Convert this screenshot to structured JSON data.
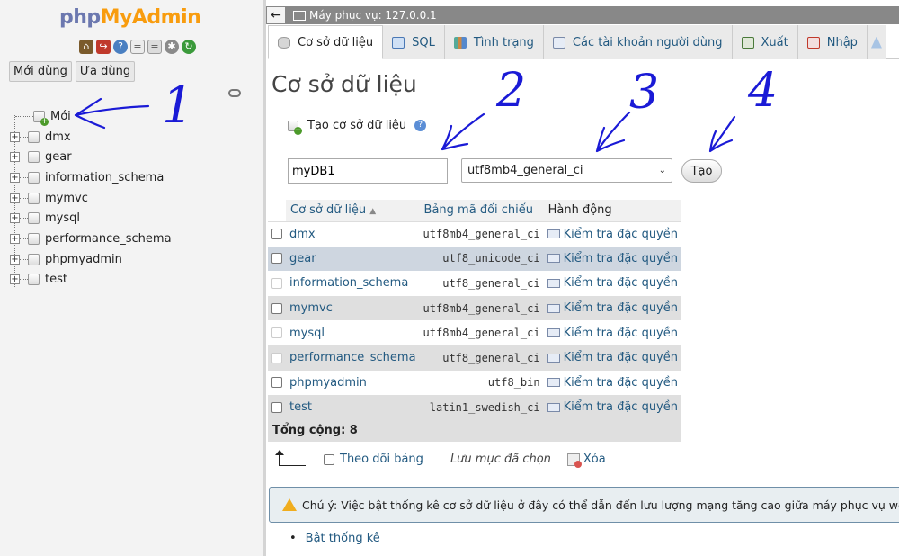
{
  "nav": {
    "logo_php": "php",
    "logo_myadmin": "MyAdmin",
    "btn_recent": "Mới dùng",
    "btn_favorite": "Ưa dùng",
    "tree": [
      {
        "name": "Mới",
        "type": "new"
      },
      {
        "name": "dmx"
      },
      {
        "name": "gear"
      },
      {
        "name": "information_schema"
      },
      {
        "name": "mymvc"
      },
      {
        "name": "mysql"
      },
      {
        "name": "performance_schema"
      },
      {
        "name": "phpmyadmin"
      },
      {
        "name": "test"
      }
    ]
  },
  "topbar": {
    "server": "Máy phục vụ: 127.0.0.1"
  },
  "tabs": [
    {
      "label": "Cơ sở dữ liệu",
      "icon": "database-icon",
      "active": true
    },
    {
      "label": "SQL",
      "icon": "sql-icon"
    },
    {
      "label": "Tình trạng",
      "icon": "status-icon"
    },
    {
      "label": "Các tài khoản người dùng",
      "icon": "users-icon"
    },
    {
      "label": "Xuất",
      "icon": "export-icon"
    },
    {
      "label": "Nhập",
      "icon": "import-icon"
    }
  ],
  "main": {
    "title": "Cơ sở dữ liệu",
    "create_label": "Tạo cơ sở dữ liệu",
    "db_name_value": "myDB1",
    "collation_selected": "utf8mb4_general_ci",
    "create_button": "Tạo"
  },
  "table": {
    "headers": {
      "name": "Cơ sở dữ liệu",
      "collation": "Bảng mã đối chiếu",
      "action": "Hành động"
    },
    "rows": [
      {
        "name": "dmx",
        "collation": "utf8mb4_general_ci",
        "action": "Kiểm tra đặc quyền"
      },
      {
        "name": "gear",
        "collation": "utf8_unicode_ci",
        "action": "Kiểm tra đặc quyền"
      },
      {
        "name": "information_schema",
        "collation": "utf8_general_ci",
        "action": "Kiểm tra đặc quyền"
      },
      {
        "name": "mymvc",
        "collation": "utf8mb4_general_ci",
        "action": "Kiểm tra đặc quyền"
      },
      {
        "name": "mysql",
        "collation": "utf8mb4_general_ci",
        "action": "Kiểm tra đặc quyền"
      },
      {
        "name": "performance_schema",
        "collation": "utf8_general_ci",
        "action": "Kiểm tra đặc quyền"
      },
      {
        "name": "phpmyadmin",
        "collation": "utf8_bin",
        "action": "Kiểm tra đặc quyền"
      },
      {
        "name": "test",
        "collation": "latin1_swedish_ci",
        "action": "Kiểm tra đặc quyền"
      }
    ],
    "total": "Tổng cộng: 8"
  },
  "bulk": {
    "check_all": "Theo dõi bảng",
    "with_selected": "Lưu mục đã chọn",
    "delete": "Xóa"
  },
  "notice": "Chú ý: Việc bật thống kê cơ sở dữ liệu ở đây có thể dẫn đến lưu lượng mạng tăng cao giữa máy phục vụ web và d",
  "stats_link": "Bật thống kê",
  "annotations": [
    "1",
    "2",
    "3",
    "4"
  ],
  "colors": {
    "link": "#235a81",
    "logo_php": "#6c78af",
    "logo_myadmin": "#f89c0e",
    "annotation_ink": "#1a1ad6"
  }
}
